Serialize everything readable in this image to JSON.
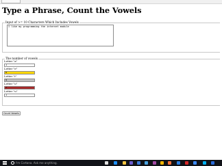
{
  "page": {
    "title": "Type a Phrase, Count the Vowels"
  },
  "input_section": {
    "legend": "Input of >= 10 Characters Which Includes Vowels",
    "phrase_value": "I like my programming the internet module"
  },
  "vowels_section": {
    "legend": "The number of vowels",
    "fields": [
      {
        "label": "Letter \"a\"",
        "value": "1",
        "highlight_color": "#ffffff"
      },
      {
        "label": "Letter \"e\"",
        "value": "6",
        "highlight_color": "#ffd700"
      },
      {
        "label": "Letter \"i\"",
        "value": "4",
        "highlight_color": "#c0c0c0"
      },
      {
        "label": "Letter \"o\"",
        "value": "2",
        "highlight_color": "#a52a2a"
      },
      {
        "label": "Letter \"u\"",
        "value": "1",
        "highlight_color": "#ffffff"
      }
    ]
  },
  "actions": {
    "count_button_label": "Count Vowels"
  },
  "taskbar": {
    "search_placeholder": "I'm Cortana. Ask me anything.",
    "icons": [
      {
        "name": "task-view-icon",
        "color": "#e0e0e0"
      },
      {
        "name": "edge-icon",
        "color": "#1e90ff"
      },
      {
        "name": "file-explorer-icon",
        "color": "#f5c542"
      },
      {
        "name": "store-icon",
        "color": "#6a5acd"
      },
      {
        "name": "mail-icon",
        "color": "#3a78d8"
      },
      {
        "name": "photos-icon",
        "color": "#4aa3df"
      },
      {
        "name": "onenote-icon",
        "color": "#a349a4"
      },
      {
        "name": "chrome-icon",
        "color": "#f4b400"
      },
      {
        "name": "firefox-icon",
        "color": "#ff7139"
      },
      {
        "name": "network-icon",
        "color": "#2a7de1"
      },
      {
        "name": "acrobat-icon",
        "color": "#d62828"
      },
      {
        "name": "media-player-icon",
        "color": "#3d8bfd"
      },
      {
        "name": "skype-icon",
        "color": "#00aff0"
      },
      {
        "name": "windows-icon",
        "color": "#2b6cd9"
      }
    ]
  }
}
